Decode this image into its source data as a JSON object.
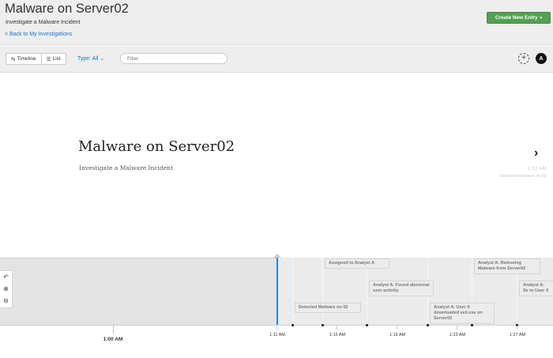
{
  "header": {
    "title": "Malware on Server02",
    "subtitle": "Investigate a Malware Incident",
    "back_link": "< Back to My Investigations",
    "create_button": "Create New Entry",
    "create_caret": "▾"
  },
  "toolbar": {
    "timeline_icon": "⇆",
    "timeline_label": "Timeline",
    "list_icon": "☰",
    "list_label": "List",
    "type_filter": "Type: All ⌄",
    "filter_placeholder": "Filter",
    "add_icon": "+",
    "avatar_letter": "A"
  },
  "slide": {
    "title": "Malware on Server02",
    "subtitle": "Investigate a Malware Incident",
    "next_arrow": "›",
    "next_time": "1:12 AM",
    "next_desc": "Detected Malware on 02"
  },
  "timeline": {
    "controls": [
      "↶",
      "⊕",
      "⊖"
    ],
    "ticks": [
      "1:00 AM",
      "1:11 AM",
      "1:15 AM",
      "1:19 AM",
      "1:23 AM",
      "1:27 AM"
    ],
    "events": [
      {
        "label": "Detected Malware on 02"
      },
      {
        "label": "Assigned to Analyst A"
      },
      {
        "label": "Analyst A: Found abnormal user activity."
      },
      {
        "label": "Analyst A: User X downloaded evil.exe on Server02"
      },
      {
        "label": "Analyst A: Removing Malware from Server02"
      },
      {
        "label": "Analyst A: Se to User X"
      }
    ]
  }
}
